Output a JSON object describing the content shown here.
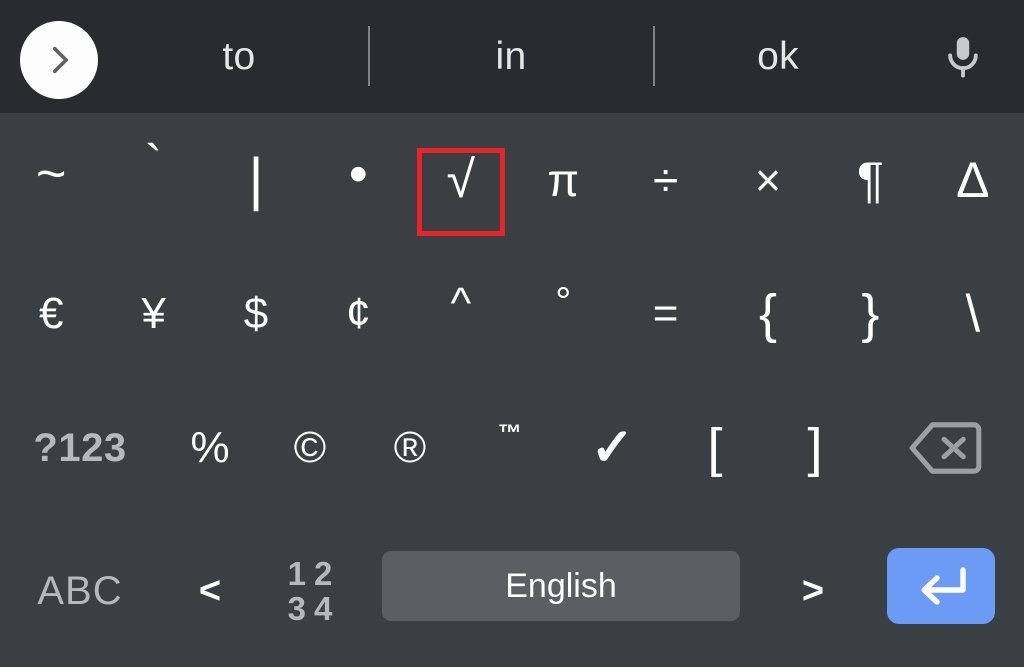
{
  "app": {
    "name": "Android Symbols Keyboard",
    "background_color": "#3a3f44",
    "suggestion_bar_color": "#282c30",
    "accent_color": "#6b9bf4",
    "highlight_color": "#e8232a"
  },
  "suggestion_bar": {
    "expand_icon": "chevron-right-icon",
    "suggestions": [
      {
        "text": "to"
      },
      {
        "text": "in"
      },
      {
        "text": "ok"
      }
    ],
    "mic_icon": "microphone-icon"
  },
  "keyboard": {
    "highlighted_key": "√",
    "rows": [
      {
        "id": "row-0",
        "keys": [
          {
            "label": "~",
            "name": "key-tilde",
            "glyph_class": "glyph-tilde"
          },
          {
            "label": "`",
            "name": "key-grave",
            "glyph_class": "glyph-grave"
          },
          {
            "label": "|",
            "name": "key-pipe",
            "glyph_class": "glyph-bar"
          },
          {
            "label": "•",
            "name": "key-bullet",
            "glyph_class": "glyph-dot"
          },
          {
            "label": "√",
            "name": "key-square-root",
            "glyph_class": "glyph-sqrt"
          },
          {
            "label": "π",
            "name": "key-pi",
            "glyph_class": "glyph-pi"
          },
          {
            "label": "÷",
            "name": "key-division",
            "glyph_class": "glyph-div"
          },
          {
            "label": "×",
            "name": "key-multiply",
            "glyph_class": "glyph-times"
          },
          {
            "label": "¶",
            "name": "key-pilcrow",
            "glyph_class": "glyph-pilcrow"
          },
          {
            "label": "Δ",
            "name": "key-delta",
            "glyph_class": "glyph-delta"
          }
        ]
      },
      {
        "id": "row-1",
        "keys": [
          {
            "label": "€",
            "name": "key-euro",
            "glyph_class": "glyph-circ"
          },
          {
            "label": "¥",
            "name": "key-yen",
            "glyph_class": "glyph-circ"
          },
          {
            "label": "$",
            "name": "key-dollar",
            "glyph_class": "glyph-circ"
          },
          {
            "label": "¢",
            "name": "key-cent",
            "glyph_class": "glyph-circ"
          },
          {
            "label": "^",
            "name": "key-caret",
            "glyph_class": "glyph-caret"
          },
          {
            "label": "°",
            "name": "key-degree",
            "glyph_class": "glyph-deg"
          },
          {
            "label": "=",
            "name": "key-equals",
            "glyph_class": "glyph-circ"
          },
          {
            "label": "{",
            "name": "key-brace-left",
            "glyph_class": "glyph-brace"
          },
          {
            "label": "}",
            "name": "key-brace-right",
            "glyph_class": "glyph-brace"
          },
          {
            "label": "\\",
            "name": "key-backslash",
            "glyph_class": "glyph-bslash"
          }
        ]
      },
      {
        "id": "row-2",
        "keys": [
          {
            "label": "?123",
            "name": "key-numbers-symbols",
            "glyph_class": "glyph-123"
          },
          {
            "label": "%",
            "name": "key-percent",
            "glyph_class": "glyph-circ"
          },
          {
            "label": "©",
            "name": "key-copyright",
            "glyph_class": "glyph-circ"
          },
          {
            "label": "®",
            "name": "key-registered",
            "glyph_class": "glyph-circ"
          },
          {
            "label": "™",
            "name": "key-trademark",
            "glyph_class": "glyph-tm"
          },
          {
            "label": "✓",
            "name": "key-checkmark",
            "glyph_class": "glyph-check"
          },
          {
            "label": "[",
            "name": "key-bracket-left",
            "glyph_class": "glyph-bracket"
          },
          {
            "label": "]",
            "name": "key-bracket-right",
            "glyph_class": "glyph-bracket"
          },
          {
            "label": "",
            "name": "key-backspace",
            "glyph_class": "",
            "icon": "backspace-icon"
          }
        ]
      }
    ],
    "bottom_row": {
      "abc_label": "ABC",
      "prev_label": "<",
      "numeric_grid": [
        "1",
        "2",
        "3",
        "4"
      ],
      "spacebar_label": "English",
      "next_label": ">",
      "enter_icon": "enter-return-icon"
    }
  }
}
